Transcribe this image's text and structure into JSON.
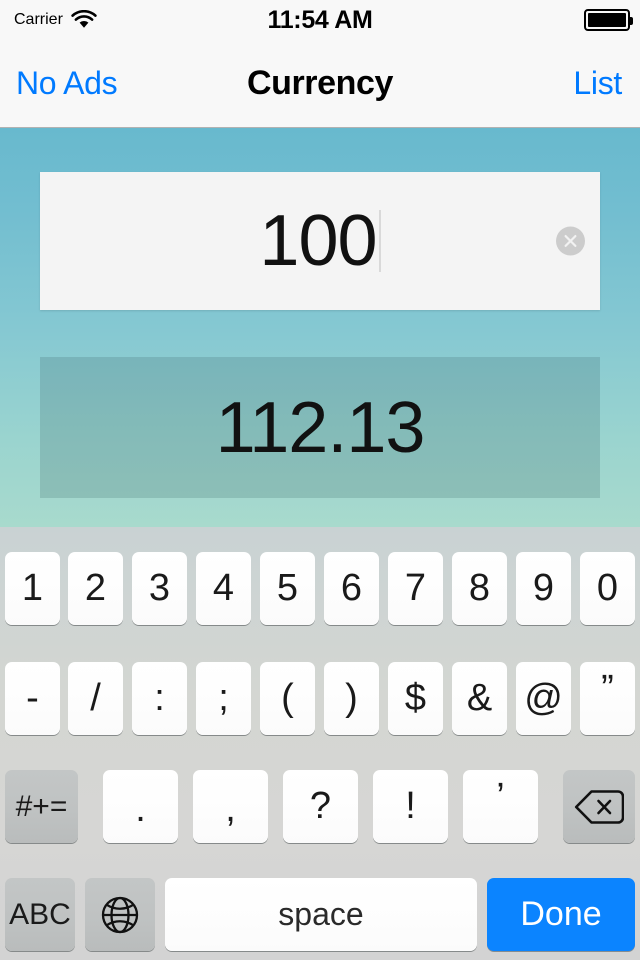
{
  "status_bar": {
    "carrier": "Carrier",
    "wifi_icon": "wifi-icon",
    "time": "11:54 AM",
    "battery_icon": "battery-icon",
    "battery_percent": 100
  },
  "nav_bar": {
    "left_button": "No Ads",
    "title": "Currency",
    "right_button": "List",
    "accent_color": "#007aff",
    "background_color": "#f8f8f8"
  },
  "content": {
    "background_gradient_top": "#68b9ce",
    "background_gradient_bottom": "#a8dacd",
    "amount_field": {
      "value": "100",
      "placeholder": "",
      "clear_icon": "clear-circle-icon",
      "background_color": "#f4f4f4"
    },
    "result_field": {
      "value": "112.13"
    }
  },
  "keyboard": {
    "background_color": "#d2d5d4",
    "rows": [
      {
        "name": "numbers",
        "keys": [
          {
            "label": "1",
            "type": "light"
          },
          {
            "label": "2",
            "type": "light"
          },
          {
            "label": "3",
            "type": "light"
          },
          {
            "label": "4",
            "type": "light"
          },
          {
            "label": "5",
            "type": "light"
          },
          {
            "label": "6",
            "type": "light"
          },
          {
            "label": "7",
            "type": "light"
          },
          {
            "label": "8",
            "type": "light"
          },
          {
            "label": "9",
            "type": "light"
          },
          {
            "label": "0",
            "type": "light"
          }
        ]
      },
      {
        "name": "symbols",
        "keys": [
          {
            "label": "-",
            "type": "light"
          },
          {
            "label": "/",
            "type": "light"
          },
          {
            "label": ":",
            "type": "light"
          },
          {
            "label": ";",
            "type": "light"
          },
          {
            "label": "(",
            "type": "light"
          },
          {
            "label": ")",
            "type": "light"
          },
          {
            "label": "$",
            "type": "light"
          },
          {
            "label": "&",
            "type": "light"
          },
          {
            "label": "@",
            "type": "light"
          },
          {
            "label": "”",
            "type": "light"
          }
        ]
      },
      {
        "name": "punctuation",
        "keys": [
          {
            "label": "#+=",
            "type": "dark"
          },
          {
            "label": ".",
            "type": "light"
          },
          {
            "label": ",",
            "type": "light"
          },
          {
            "label": "?",
            "type": "light"
          },
          {
            "label": "!",
            "type": "light"
          },
          {
            "label": "’",
            "type": "light"
          },
          {
            "label": "",
            "type": "dark",
            "icon": "backspace-icon"
          }
        ]
      },
      {
        "name": "bottom",
        "keys": [
          {
            "label": "ABC",
            "type": "dark"
          },
          {
            "label": "",
            "type": "dark",
            "icon": "globe-icon"
          },
          {
            "label": "space",
            "type": "light"
          },
          {
            "label": "Done",
            "type": "blue"
          }
        ]
      }
    ]
  }
}
